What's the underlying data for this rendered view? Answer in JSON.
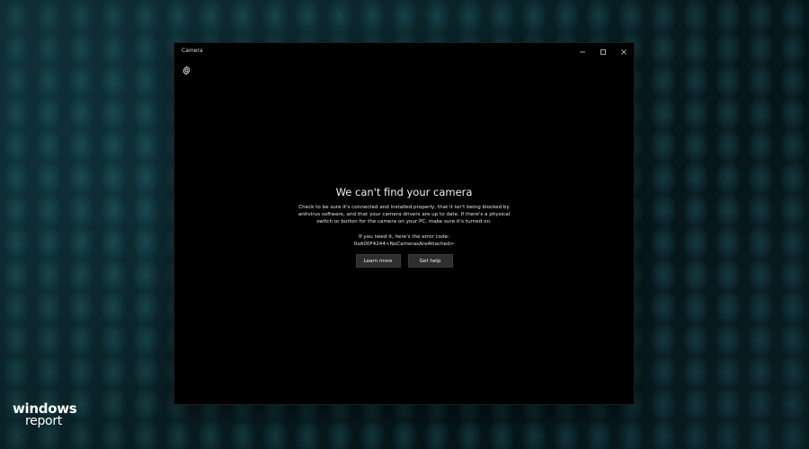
{
  "window": {
    "title": "Camera",
    "controls": {
      "minimize_icon": "minimize-icon",
      "maximize_icon": "maximize-icon",
      "close_icon": "close-icon"
    },
    "settings_icon": "gear-icon"
  },
  "error": {
    "heading": "We can't find your camera",
    "message": "Check to be sure it's connected and installed properly, that it isn't being blocked by antivirus software, and that your camera drivers are up to date. If there's a physical switch or button for the camera on your PC, make sure it's turned on.",
    "code_label": "If you need it, here's the error code:",
    "code": "0xA00F4244<NoCamerasAreAttached>"
  },
  "buttons": {
    "learn_more": "Learn more",
    "get_help": "Get help"
  },
  "watermark": {
    "line1": "windows",
    "line2": "report"
  },
  "colors": {
    "window_bg": "#000000",
    "button_bg": "#2e2e2e",
    "desktop_bg": "#0f2c33"
  }
}
